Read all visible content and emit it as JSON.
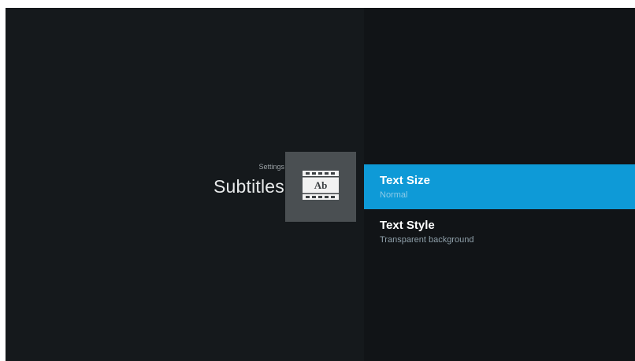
{
  "header": {
    "breadcrumb": "Settings",
    "title": "Subtitles"
  },
  "icon": {
    "name": "subtitles-film-icon",
    "glyph": "Ab"
  },
  "menu": {
    "items": [
      {
        "title": "Text Size",
        "subtitle": "Normal",
        "selected": true
      },
      {
        "title": "Text Style",
        "subtitle": "Transparent background",
        "selected": false
      }
    ]
  },
  "colors": {
    "background": "#15191c",
    "panel": "#111417",
    "accent": "#0e9ad7",
    "tile": "#4a4f52"
  }
}
